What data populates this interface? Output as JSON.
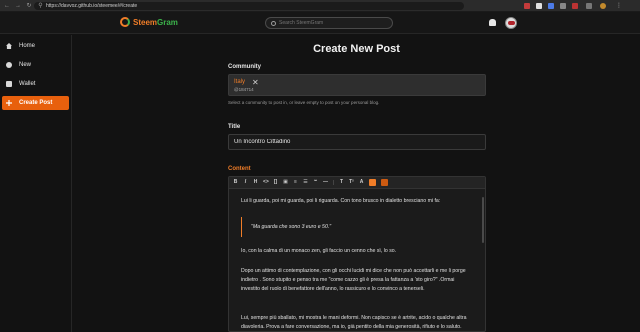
{
  "browser": {
    "url": "https://davvoz.github.io/steemee/#/create"
  },
  "header": {
    "brand_first": "Steem",
    "brand_second": "Gram",
    "search_placeholder": "Search SteemGram"
  },
  "sidebar": {
    "items": [
      {
        "label": "Home",
        "icon": "home-icon"
      },
      {
        "label": "New",
        "icon": "new-icon"
      },
      {
        "label": "Wallet",
        "icon": "wallet-icon"
      },
      {
        "label": "Create Post",
        "icon": "create-post-icon",
        "active": true
      }
    ]
  },
  "main": {
    "title": "Create New Post",
    "community_label": "Community",
    "community_name": "Italy",
    "community_id": "@184714",
    "community_help": "Select a community to post in, or leave empty to post on your personal blog.",
    "title_label": "Title",
    "title_value": "Un Incontro Cittadino",
    "content_label": "Content"
  },
  "editor": {
    "toolbar": [
      "B",
      "I",
      "H",
      "<>",
      "[]",
      "▣",
      "≡",
      "☰",
      "❝",
      "—",
      "T",
      "T²",
      "A",
      "◧",
      "◨"
    ],
    "paragraphs": [
      "Lui li guarda, poi mi guarda, poi li riguarda. Con tono brusco in dialetto bresciano mi fa:",
      "\"Ma guarda che sono 3 euro e 50.\"",
      "Io, con la calma di un monaco zen, gli faccio un cenno che sì, lo so.",
      "Dopo un attimo di contemplazione, con gli occhi lucidi mi dice che non può accettarli e me li porge indietro . Sono stupito e penso tra me \"come cazzo gli è presa la fattanza a 'sto giro?\" .Ormai investito del ruolo di benefattore dell'anno, lo rassicuro e lo convinco a tenerseli.",
      "Lui, sempre più sballato, mi mostra le mani deformi. Non capisco se è artrite, acido o qualche altra diavoleria. Prova a fare conversazione, ma io, già pentito della mia generosità, rifiuto e lo saluto."
    ]
  }
}
